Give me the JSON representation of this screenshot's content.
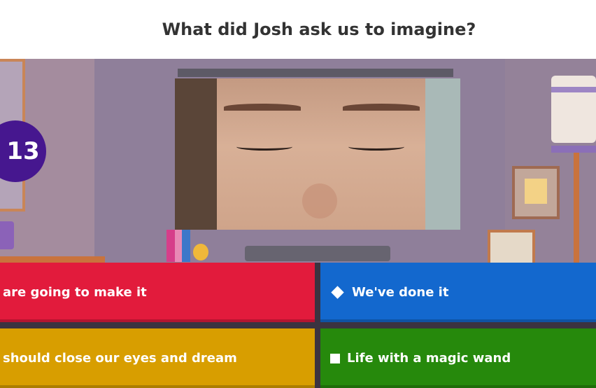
{
  "question": "What did Josh ask us to imagine?",
  "timer": "13",
  "answers": [
    {
      "text": "are going to make it",
      "color": "#e21b3c",
      "shape": ""
    },
    {
      "text": "We've done it",
      "color": "#1368ce",
      "shape": "diamond-icon"
    },
    {
      "text": "should close our eyes and dream",
      "color": "#d89e00",
      "shape": ""
    },
    {
      "text": "Life with a magic wand",
      "color": "#26890c",
      "shape": "square-icon"
    }
  ]
}
